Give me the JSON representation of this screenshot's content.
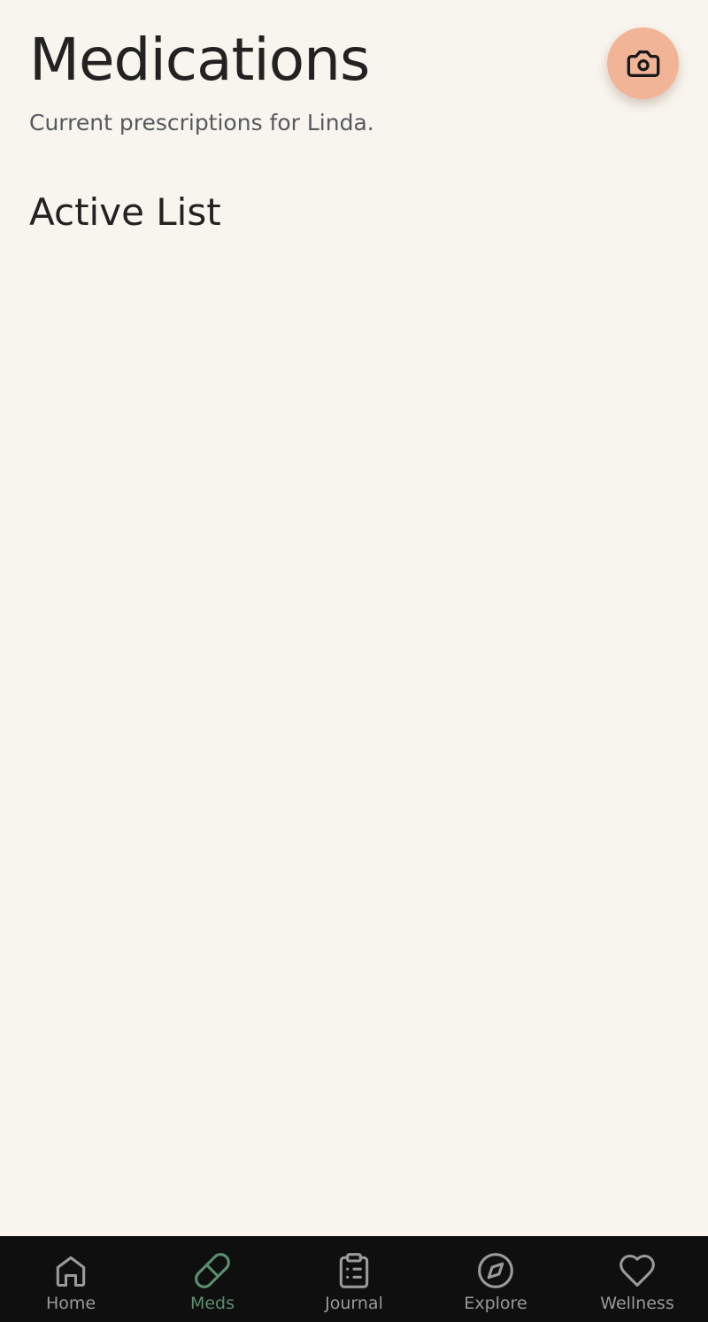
{
  "header": {
    "title": "Medications",
    "subtitle": "Current prescriptions for Linda."
  },
  "section": {
    "title": "Active List",
    "items": []
  },
  "camera_button": {
    "icon": "camera-icon",
    "background_color": "#f2b497"
  },
  "nav": {
    "items": [
      {
        "label": "Home",
        "icon": "home-icon",
        "active": false
      },
      {
        "label": "Meds",
        "icon": "pill-icon",
        "active": true
      },
      {
        "label": "Journal",
        "icon": "clipboard-list-icon",
        "active": false
      },
      {
        "label": "Explore",
        "icon": "compass-icon",
        "active": false
      },
      {
        "label": "Wellness",
        "icon": "heart-icon",
        "active": false
      }
    ],
    "active_color": "#5b8f70",
    "inactive_color": "#9a9a9a",
    "background_color": "#0f0f0f"
  },
  "colors": {
    "background": "#f8f5ee",
    "text_primary": "#222222",
    "text_secondary": "#55595e"
  }
}
